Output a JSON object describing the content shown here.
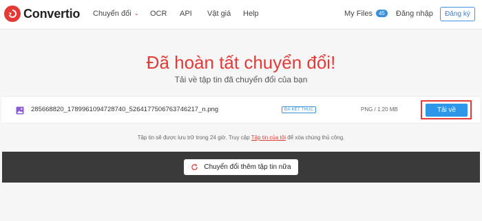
{
  "header": {
    "logo_text": "Convertio",
    "nav": {
      "convert": "Chuyển đổi",
      "ocr": "OCR",
      "api": "API",
      "pricing": "Vật giá",
      "help": "Help"
    },
    "my_files_label": "My Files",
    "my_files_count": "45",
    "login": "Đăng nhập",
    "signup": "Đăng ký"
  },
  "main": {
    "title": "Đã hoàn tất chuyển đổi!",
    "subtitle": "Tải về tập tin đã chuyển đổi của bạn"
  },
  "file": {
    "name": "285668820_1789961094728740_5264177506763746217_n.png",
    "status": "ĐÃ KẾT THÚC",
    "meta": "PNG / 1.20 MB",
    "download_label": "Tải về"
  },
  "note": {
    "before": "Tập tin sẽ được lưu trữ trong 24 giờ. Truy cập ",
    "link": "Tập tin của tôi",
    "after": " để xóa chúng thủ công."
  },
  "actions": {
    "convert_more": "Chuyển đổi thêm tập tin nữa"
  },
  "colors": {
    "brand_red": "#e53935",
    "accent_blue": "#2f97e9"
  },
  "icons": [
    "convertio-logo-icon",
    "chevron-down-icon",
    "image-file-icon",
    "refresh-icon"
  ]
}
